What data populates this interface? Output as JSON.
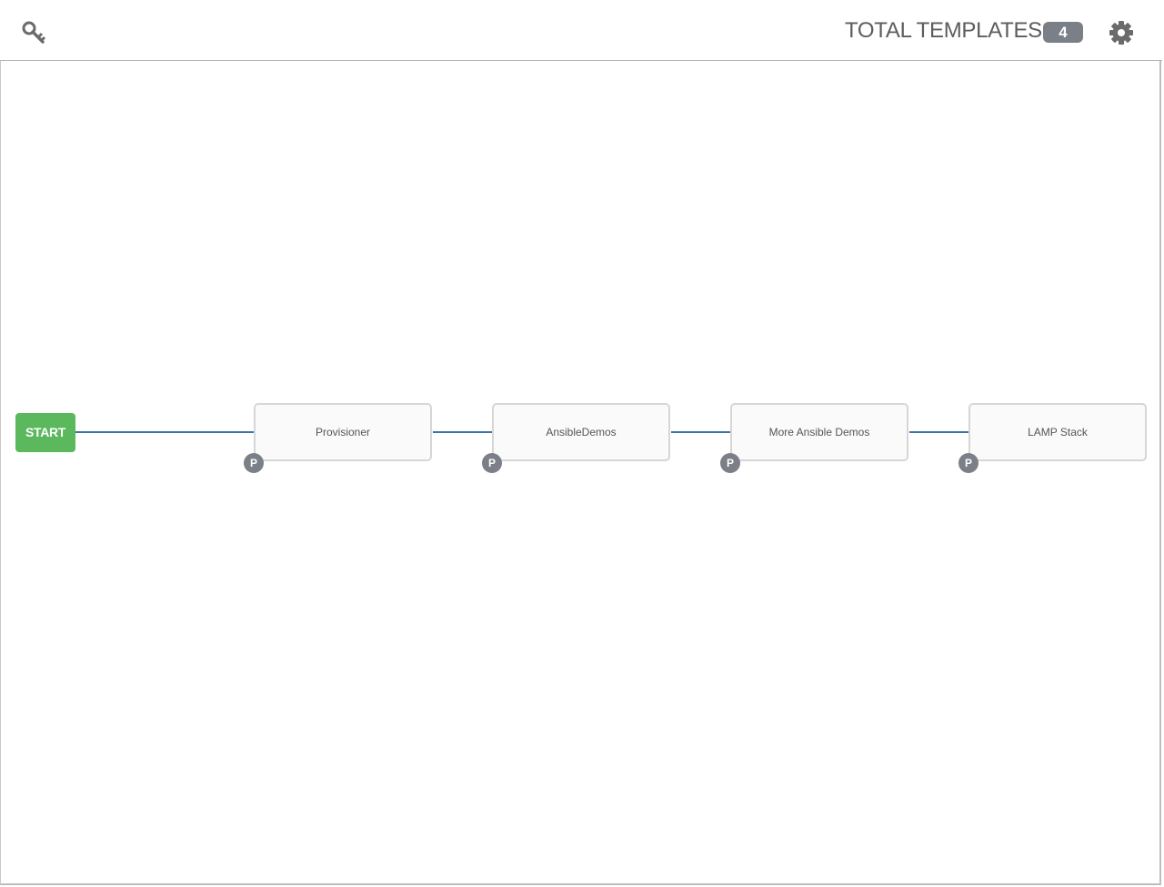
{
  "header": {
    "left_icon": "key-icon",
    "title": "TOTAL TEMPLATES",
    "count": "4",
    "right_icon": "gear-icon"
  },
  "workflow": {
    "start_label": "START",
    "nodes": [
      {
        "label": "Provisioner",
        "badge": "P"
      },
      {
        "label": "AnsibleDemos",
        "badge": "P"
      },
      {
        "label": "More Ansible Demos",
        "badge": "P"
      },
      {
        "label": "LAMP Stack",
        "badge": "P"
      }
    ],
    "link_color": "#3a74a8",
    "start_color": "#5cb85c",
    "badge_color": "#7b7f87"
  }
}
